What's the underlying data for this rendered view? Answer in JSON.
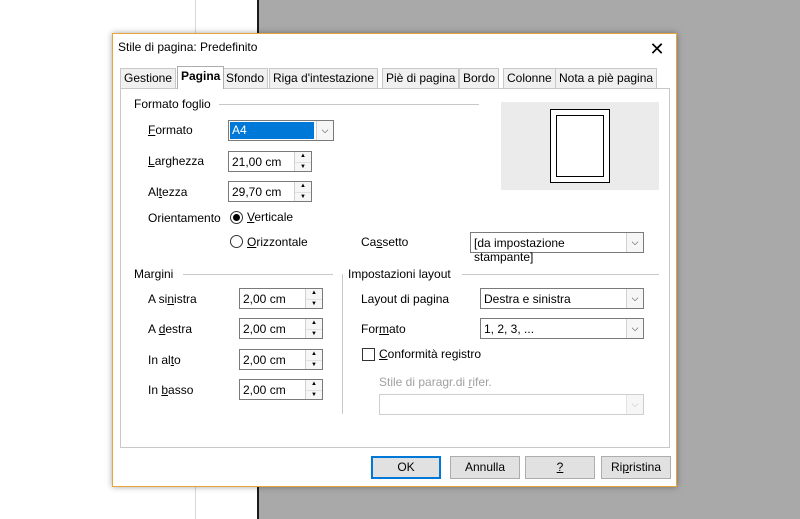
{
  "window": {
    "title": "Stile di pagina: Predefinito",
    "close_symbol": "✕"
  },
  "tabs": [
    {
      "label": "Gestione"
    },
    {
      "label": "Pagina",
      "active": true
    },
    {
      "label": "Sfondo"
    },
    {
      "label": "Riga d'intestazione"
    },
    {
      "label": "Piè di pagina"
    },
    {
      "label": "Bordo"
    },
    {
      "label": "Colonne"
    },
    {
      "label": "Nota a piè pagina"
    }
  ],
  "paper_format": {
    "heading": "Formato foglio",
    "format": {
      "label_mn": "F",
      "label_rest": "ormato",
      "value": "A4"
    },
    "width": {
      "label_mn": "L",
      "label_rest": "arghezza",
      "value": "21,00 cm"
    },
    "height": {
      "label_pre": "Al",
      "label_mn": "t",
      "label_rest": "ezza",
      "value": "29,70 cm"
    },
    "orientation": {
      "label": "Orientamento",
      "portrait": {
        "label_mn": "V",
        "label_rest": "erticale",
        "selected": true
      },
      "landscape": {
        "label_mn": "O",
        "label_rest": "rizzontale",
        "selected": false
      }
    },
    "tray": {
      "label_pre": "Ca",
      "label_mn": "s",
      "label_rest": "setto",
      "value": "[da impostazione stampante]"
    }
  },
  "margins": {
    "heading": "Margini",
    "left": {
      "label_pre": "A si",
      "label_mn": "n",
      "label_rest": "istra",
      "value": "2,00 cm"
    },
    "right": {
      "label_pre": "A ",
      "label_mn": "d",
      "label_rest": "estra",
      "value": "2,00 cm"
    },
    "top": {
      "label_pre": "In al",
      "label_mn": "t",
      "label_rest": "o",
      "value": "2,00 cm"
    },
    "bottom": {
      "label_pre": "In ",
      "label_mn": "b",
      "label_rest": "asso",
      "value": "2,00 cm"
    }
  },
  "layout_settings": {
    "heading": "Impostazioni layout",
    "page_layout": {
      "label_pre": "Layout di pa",
      "label_mn": "g",
      "label_rest": "ina",
      "value": "Destra e sinistra"
    },
    "format": {
      "label_pre": "For",
      "label_mn": "m",
      "label_rest": "ato",
      "value": "1, 2, 3, ..."
    },
    "register_true": {
      "label_mn": "C",
      "label_rest": "onformità registro",
      "checked": false
    },
    "reference_style": {
      "label_pre": "Stile di paragr.di ",
      "label_mn": "r",
      "label_rest": "ifer.",
      "value": ""
    }
  },
  "buttons": {
    "ok": "OK",
    "cancel": "Annulla",
    "help_mn": "?",
    "reset_pre": "Ri",
    "reset_mn": "p",
    "reset_rest": "ristina"
  },
  "icons": {
    "combo_arrow": "chevron-down-icon",
    "spin_up": "▲",
    "spin_down": "▼",
    "arrow_glyph": "⌵"
  },
  "colors": {
    "accent": "#0078d7",
    "dialog_border": "#e8a33c",
    "preview_bg": "#ebebeb"
  }
}
